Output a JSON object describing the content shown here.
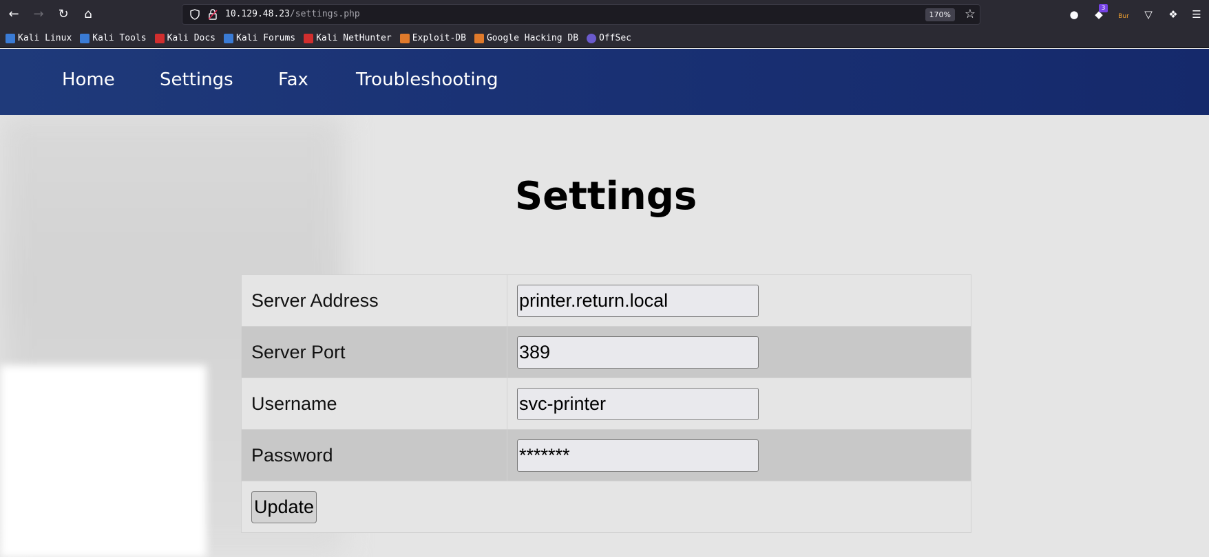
{
  "browser": {
    "url_host": "10.129.48.23",
    "url_path": "/settings.php",
    "zoom": "170%",
    "extension_badge": "3",
    "burp_label": "Bur",
    "bookmarks": [
      {
        "label": "Kali Linux",
        "color": "#3a7bd5"
      },
      {
        "label": "Kali Tools",
        "color": "#3a7bd5"
      },
      {
        "label": "Kali Docs",
        "color": "#d12e2e"
      },
      {
        "label": "Kali Forums",
        "color": "#3a7bd5"
      },
      {
        "label": "Kali NetHunter",
        "color": "#d12e2e"
      },
      {
        "label": "Exploit-DB",
        "color": "#e07a2b"
      },
      {
        "label": "Google Hacking DB",
        "color": "#e07a2b"
      },
      {
        "label": "OffSec",
        "color": "#6a5acd"
      }
    ]
  },
  "nav": {
    "home": "Home",
    "settings": "Settings",
    "fax": "Fax",
    "troubleshooting": "Troubleshooting"
  },
  "page": {
    "title": "Settings"
  },
  "form": {
    "server_address_label": "Server Address",
    "server_address_value": "printer.return.local",
    "server_port_label": "Server Port",
    "server_port_value": "389",
    "username_label": "Username",
    "username_value": "svc-printer",
    "password_label": "Password",
    "password_value": "*******",
    "update_label": "Update"
  },
  "colors": {
    "navbar": "#1a3275",
    "row_light": "#e5e5e5",
    "row_dark": "#c8c8c8"
  }
}
